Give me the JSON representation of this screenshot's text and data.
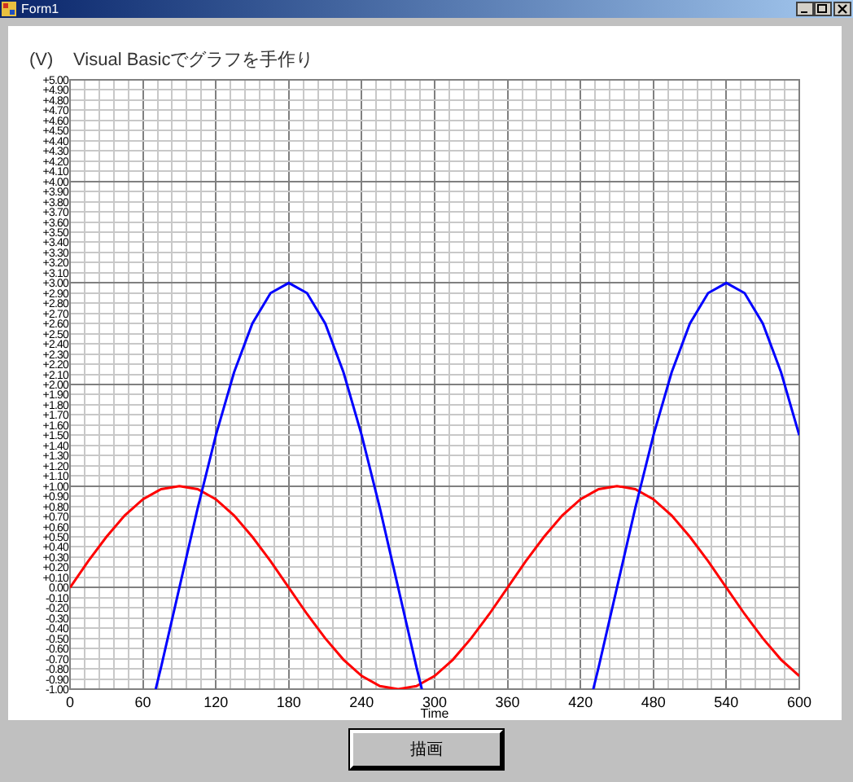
{
  "window": {
    "title": "Form1"
  },
  "graph": {
    "chart_data": {
      "type": "line",
      "title": "Visual Basicでグラフを手作り",
      "ylabel": "(V)",
      "xlabel": "Time",
      "x": [
        0,
        15,
        30,
        45,
        60,
        70.5,
        75,
        90,
        105,
        120,
        135,
        150,
        165,
        180,
        195,
        210,
        225,
        240,
        255,
        270,
        285,
        289.5,
        300,
        315,
        330,
        345,
        360,
        375,
        390,
        405,
        420,
        430.5,
        435,
        450,
        465,
        480,
        495,
        510,
        525,
        540,
        555,
        570,
        585,
        600
      ],
      "series": [
        {
          "color": "#ff0000",
          "values": [
            0,
            0.26,
            0.5,
            0.71,
            0.87,
            0.94,
            0.97,
            1,
            0.97,
            0.87,
            0.71,
            0.5,
            0.26,
            0,
            -0.26,
            -0.5,
            -0.71,
            -0.87,
            -0.97,
            -1,
            -0.97,
            -0.94,
            -0.87,
            -0.71,
            -0.5,
            -0.26,
            0,
            0.26,
            0.5,
            0.71,
            0.87,
            0.94,
            0.97,
            1,
            0.97,
            0.87,
            0.71,
            0.5,
            0.26,
            0,
            -0.26,
            -0.5,
            -0.71,
            -0.87
          ]
        },
        {
          "color": "#0000ff",
          "values": [
            null,
            null,
            null,
            null,
            null,
            -1,
            -0.78,
            0,
            0.78,
            1.5,
            2.12,
            2.6,
            2.9,
            3,
            2.9,
            2.6,
            2.12,
            1.5,
            0.78,
            0,
            -0.78,
            -1,
            null,
            null,
            null,
            null,
            null,
            null,
            null,
            null,
            null,
            -1,
            -0.78,
            0,
            0.78,
            1.5,
            2.12,
            2.6,
            2.9,
            3,
            2.9,
            2.6,
            2.12,
            1.5
          ]
        }
      ],
      "grid": true,
      "xlim": [
        0,
        600
      ],
      "ylim": [
        -1,
        5
      ],
      "xticks": [
        0,
        60,
        120,
        180,
        240,
        300,
        360,
        420,
        480,
        540,
        600
      ],
      "yticks": [
        {
          "value": 5,
          "label": "+5.00"
        },
        {
          "value": 4.9,
          "label": "+4.90"
        },
        {
          "value": 4.8,
          "label": "+4.80"
        },
        {
          "value": 4.7,
          "label": "+4.70"
        },
        {
          "value": 4.6,
          "label": "+4.60"
        },
        {
          "value": 4.5,
          "label": "+4.50"
        },
        {
          "value": 4.4,
          "label": "+4.40"
        },
        {
          "value": 4.3,
          "label": "+4.30"
        },
        {
          "value": 4.2,
          "label": "+4.20"
        },
        {
          "value": 4.1,
          "label": "+4.10"
        },
        {
          "value": 4,
          "label": "+4.00"
        },
        {
          "value": 3.9,
          "label": "+3.90"
        },
        {
          "value": 3.8,
          "label": "+3.80"
        },
        {
          "value": 3.7,
          "label": "+3.70"
        },
        {
          "value": 3.6,
          "label": "+3.60"
        },
        {
          "value": 3.5,
          "label": "+3.50"
        },
        {
          "value": 3.4,
          "label": "+3.40"
        },
        {
          "value": 3.3,
          "label": "+3.30"
        },
        {
          "value": 3.2,
          "label": "+3.20"
        },
        {
          "value": 3.1,
          "label": "+3.10"
        },
        {
          "value": 3,
          "label": "+3.00"
        },
        {
          "value": 2.9,
          "label": "+2.90"
        },
        {
          "value": 2.8,
          "label": "+2.80"
        },
        {
          "value": 2.7,
          "label": "+2.70"
        },
        {
          "value": 2.6,
          "label": "+2.60"
        },
        {
          "value": 2.5,
          "label": "+2.50"
        },
        {
          "value": 2.4,
          "label": "+2.40"
        },
        {
          "value": 2.3,
          "label": "+2.30"
        },
        {
          "value": 2.2,
          "label": "+2.20"
        },
        {
          "value": 2.1,
          "label": "+2.10"
        },
        {
          "value": 2,
          "label": "+2.00"
        },
        {
          "value": 1.9,
          "label": "+1.90"
        },
        {
          "value": 1.8,
          "label": "+1.80"
        },
        {
          "value": 1.7,
          "label": "+1.70"
        },
        {
          "value": 1.6,
          "label": "+1.60"
        },
        {
          "value": 1.5,
          "label": "+1.50"
        },
        {
          "value": 1.4,
          "label": "+1.40"
        },
        {
          "value": 1.3,
          "label": "+1.30"
        },
        {
          "value": 1.2,
          "label": "+1.20"
        },
        {
          "value": 1.1,
          "label": "+1.10"
        },
        {
          "value": 1,
          "label": "+1.00"
        },
        {
          "value": 0.9,
          "label": "+0.90"
        },
        {
          "value": 0.8,
          "label": "+0.80"
        },
        {
          "value": 0.7,
          "label": "+0.70"
        },
        {
          "value": 0.6,
          "label": "+0.60"
        },
        {
          "value": 0.5,
          "label": "+0.50"
        },
        {
          "value": 0.4,
          "label": "+0.40"
        },
        {
          "value": 0.3,
          "label": "+0.30"
        },
        {
          "value": 0.2,
          "label": "+0.20"
        },
        {
          "value": 0.1,
          "label": "+0.10"
        },
        {
          "value": 0,
          "label": "0.00"
        },
        {
          "value": -0.1,
          "label": "-0.10"
        },
        {
          "value": -0.2,
          "label": "-0.20"
        },
        {
          "value": -0.3,
          "label": "-0.30"
        },
        {
          "value": -0.4,
          "label": "-0.40"
        },
        {
          "value": -0.5,
          "label": "-0.50"
        },
        {
          "value": -0.6,
          "label": "-0.60"
        },
        {
          "value": -0.7,
          "label": "-0.70"
        },
        {
          "value": -0.8,
          "label": "-0.80"
        },
        {
          "value": -0.9,
          "label": "-0.90"
        },
        {
          "value": -1,
          "label": "-1.00"
        }
      ]
    }
  },
  "draw_button": {
    "label": "描画"
  }
}
